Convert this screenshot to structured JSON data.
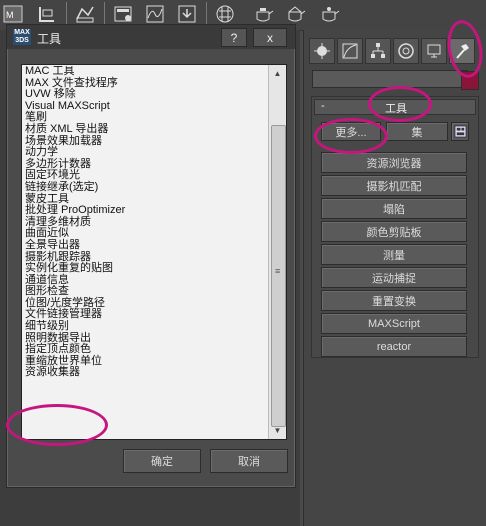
{
  "toolbar": {
    "icons": [
      "max-logo-icon",
      "layer-icon",
      "wave-icon",
      "render-setup-icon",
      "render-frame-icon",
      "curve-editor-icon",
      "save-render-icon",
      "material-editor-icon",
      "teapot-render-icon",
      "teapot-quick-icon",
      "teapot-active-icon"
    ]
  },
  "command_panel": {
    "tabs": [
      "create-tab",
      "modify-tab",
      "hierarchy-tab",
      "motion-tab",
      "display-tab",
      "utilities-tab"
    ],
    "rollout": {
      "collapse": "-",
      "title": "工具",
      "more_button": "更多...",
      "sets_button": "集",
      "tools": [
        "资源浏览器",
        "摄影机匹配",
        "塌陷",
        "颜色剪贴板",
        "测量",
        "运动捕捉",
        "重置变换",
        "MAXScript",
        "reactor"
      ]
    },
    "accent_color": "#8b1538"
  },
  "dialog": {
    "logo": "MAX 3DS",
    "title": "工具",
    "help_button": "?",
    "close_button": "x",
    "items": [
      "MAC 工具",
      "MAX 文件查找程序",
      "UVW 移除",
      "Visual MAXScript",
      "笔刷",
      "材质 XML 导出器",
      "场景效果加载器",
      "动力学",
      "多边形计数器",
      "固定环境光",
      "链接继承(选定)",
      "蒙皮工具",
      "批处理 ProOptimizer",
      "清理多维材质",
      "曲面近似",
      "全景导出器",
      "摄影机跟踪器",
      "实例化重复的贴图",
      "通道信息",
      "图形检查",
      "位图/光度学路径",
      "文件链接管理器",
      "细节级别",
      "照明数据导出",
      "指定顶点颜色",
      "重缩放世界单位",
      "资源收集器"
    ],
    "ok_button": "确定",
    "cancel_button": "取消"
  },
  "annotation_color": "#c7157f"
}
